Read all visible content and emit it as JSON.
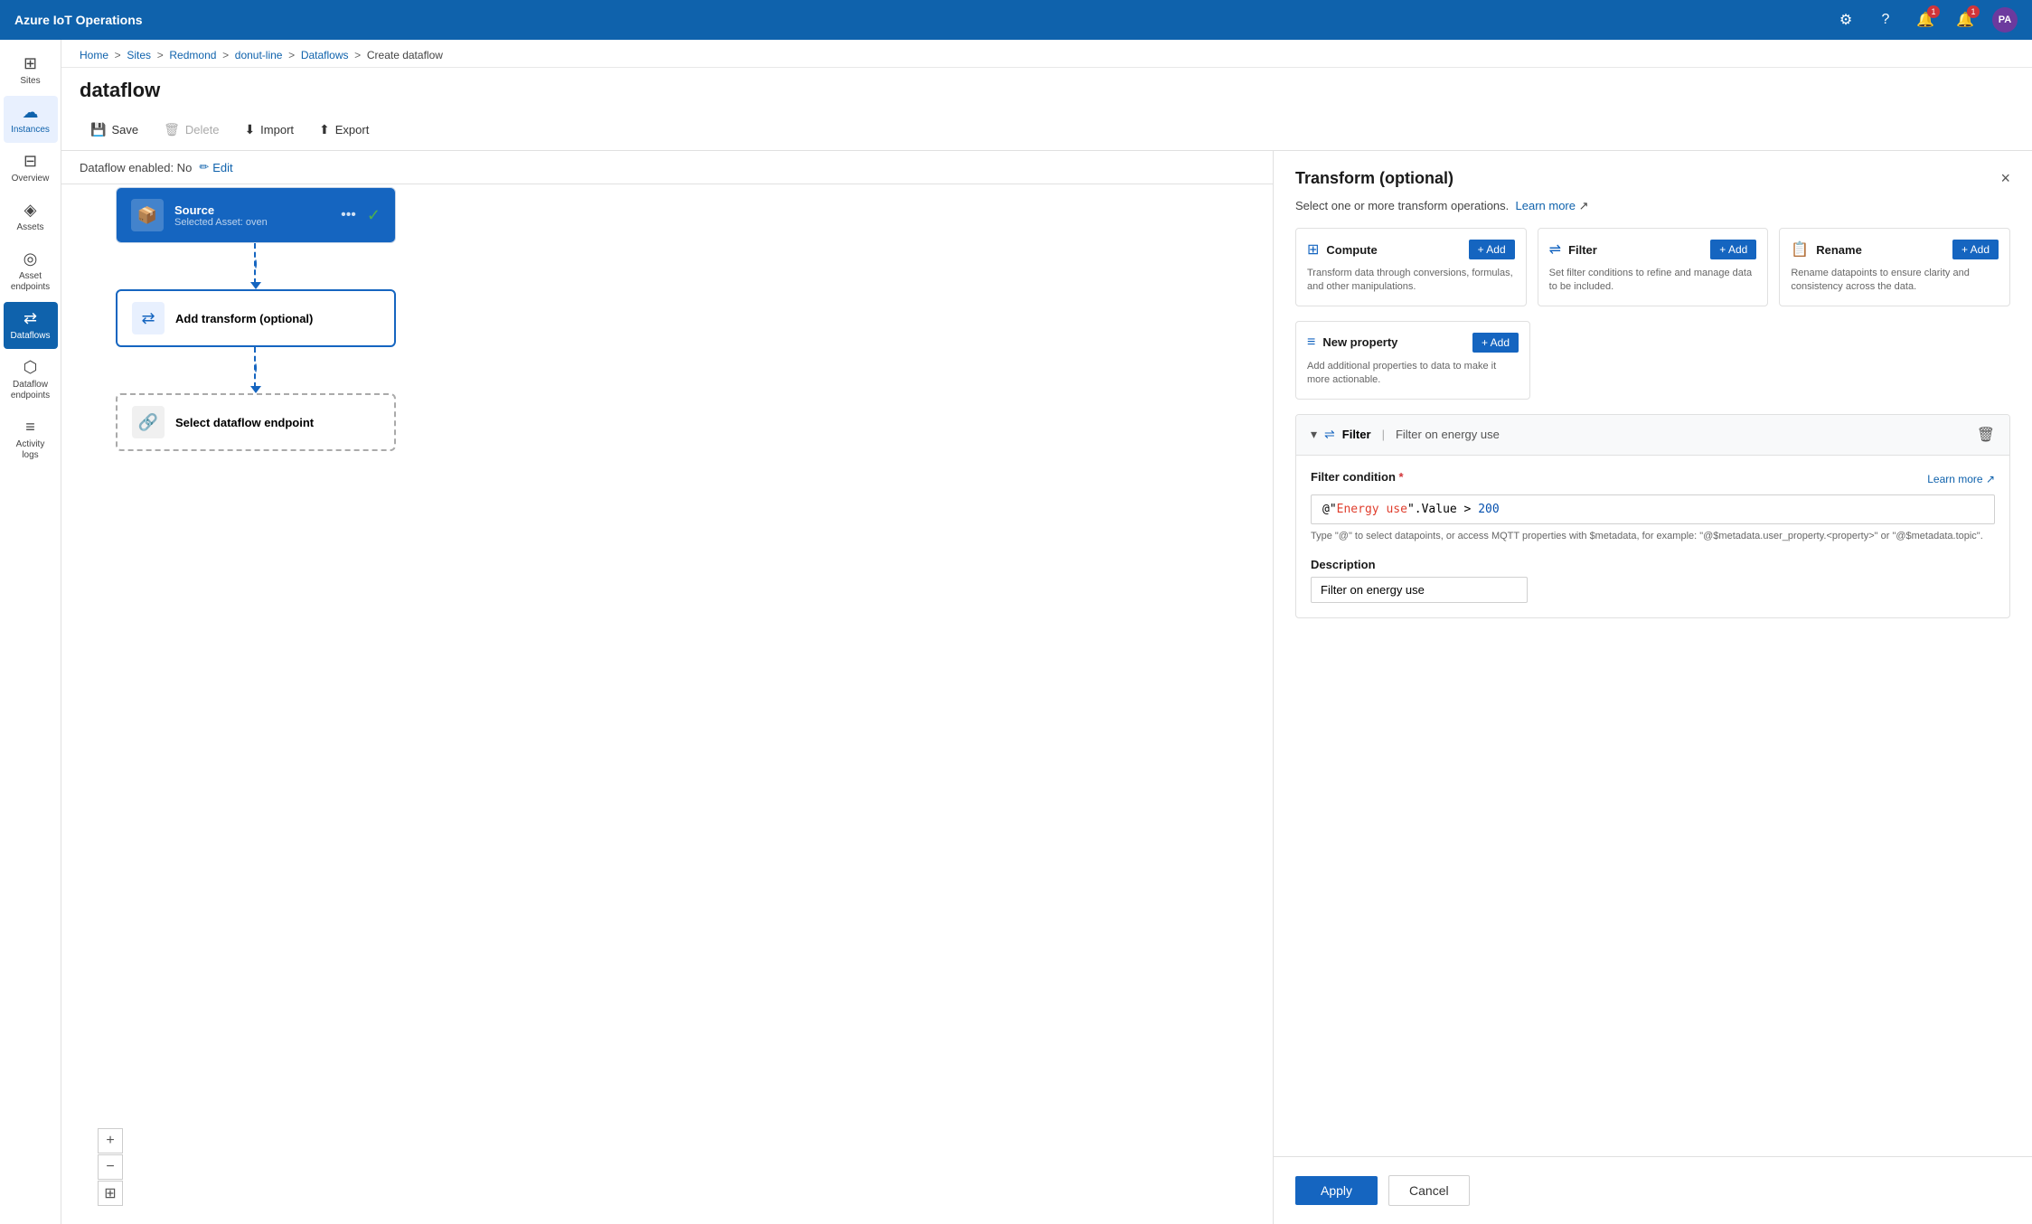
{
  "app": {
    "title": "Azure IoT Operations"
  },
  "topnav": {
    "title": "Azure IoT Operations",
    "icons": {
      "settings": "⚙",
      "help": "?",
      "notifications_bell": "🔔",
      "alert_bell": "🔔"
    },
    "badges": {
      "notifications": "1",
      "alerts": "1"
    },
    "user_initials": "PA"
  },
  "sidebar": {
    "items": [
      {
        "id": "sites",
        "label": "Sites",
        "icon": "⊞"
      },
      {
        "id": "instances",
        "label": "Instances",
        "icon": "☁"
      },
      {
        "id": "overview",
        "label": "Overview",
        "icon": "⊟"
      },
      {
        "id": "assets",
        "label": "Assets",
        "icon": "◈"
      },
      {
        "id": "asset-endpoints",
        "label": "Asset endpoints",
        "icon": "◎"
      },
      {
        "id": "dataflows",
        "label": "Dataflows",
        "icon": "⇄"
      },
      {
        "id": "dataflow-endpoints",
        "label": "Dataflow endpoints",
        "icon": "⬡"
      },
      {
        "id": "activity-logs",
        "label": "Activity logs",
        "icon": "≡"
      }
    ]
  },
  "breadcrumb": {
    "parts": [
      "Home",
      "Sites",
      "Redmond",
      "donut-line",
      "Dataflows",
      "Create dataflow"
    ],
    "separators": [
      ">",
      ">",
      ">",
      ">",
      ">"
    ]
  },
  "page": {
    "title": "dataflow"
  },
  "toolbar": {
    "buttons": [
      {
        "id": "save",
        "label": "Save",
        "icon": "💾",
        "disabled": false
      },
      {
        "id": "delete",
        "label": "Delete",
        "icon": "🗑",
        "disabled": true
      },
      {
        "id": "import",
        "label": "Import",
        "icon": "⬇",
        "disabled": false
      },
      {
        "id": "export",
        "label": "Export",
        "icon": "⬆",
        "disabled": false
      }
    ]
  },
  "status": {
    "text": "Dataflow enabled: No",
    "edit_label": "Edit"
  },
  "flow": {
    "source": {
      "title": "Source",
      "subtitle": "Selected Asset: oven",
      "icon": "📦"
    },
    "transform": {
      "title": "Add transform (optional)",
      "icon": "⇄"
    },
    "endpoint": {
      "title": "Select dataflow endpoint",
      "icon": "🔗"
    }
  },
  "panel": {
    "title": "Transform (optional)",
    "subtitle": "Select one or more transform operations.",
    "learn_more": "Learn more",
    "close_label": "×",
    "cards": [
      {
        "id": "compute",
        "icon": "⊞",
        "title": "Compute",
        "add_label": "+ Add",
        "description": "Transform data through conversions, formulas, and other manipulations."
      },
      {
        "id": "filter",
        "icon": "⇌",
        "title": "Filter",
        "add_label": "+ Add",
        "description": "Set filter conditions to refine and manage data to be included."
      },
      {
        "id": "rename",
        "icon": "📋",
        "title": "Rename",
        "add_label": "+ Add",
        "description": "Rename datapoints to ensure clarity and consistency across the data."
      }
    ],
    "new_property": {
      "id": "new-property",
      "icon": "≡",
      "title": "New property",
      "add_label": "+ Add",
      "description": "Add additional properties to data to make it more actionable."
    },
    "filter_instance": {
      "name": "Filter",
      "description": "Filter on energy use",
      "condition_label": "Filter condition",
      "condition_required": true,
      "condition_value": "@\"Energy use\".Value > 200",
      "learn_more": "Learn more",
      "hint": "Type \"@\" to select datapoints, or access MQTT properties with $metadata, for example: \"@$metadata.user_property.<property>\" or \"@$metadata.topic\".",
      "desc_label": "Description",
      "desc_value": "Filter on energy use"
    },
    "apply_label": "Apply",
    "cancel_label": "Cancel"
  },
  "zoom": {
    "plus": "+",
    "minus": "−",
    "reset": "⊞"
  }
}
